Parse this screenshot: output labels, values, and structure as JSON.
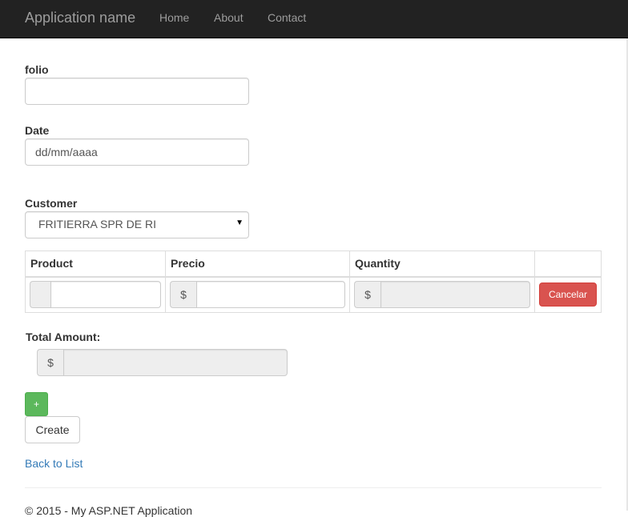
{
  "navbar": {
    "brand": "Application name",
    "links": [
      "Home",
      "About",
      "Contact"
    ]
  },
  "form": {
    "folio": {
      "label": "folio",
      "value": ""
    },
    "date": {
      "label": "Date",
      "placeholder": "dd/mm/aaaa"
    },
    "customer": {
      "label": "Customer",
      "selected": "FRITIERRA SPR DE RI"
    }
  },
  "table": {
    "headers": [
      "Product",
      "Precio",
      "Quantity",
      ""
    ],
    "row": {
      "product_addon": "",
      "precio_addon": "$",
      "quantity_addon": "$",
      "cancel_label": "Cancelar"
    }
  },
  "total": {
    "label": "Total Amount:",
    "addon": "$"
  },
  "actions": {
    "add_label": "+",
    "create_label": "Create",
    "back_link": "Back to List"
  },
  "footer": {
    "text": "© 2015 - My ASP.NET Application"
  },
  "colors": {
    "navbar": "#222222",
    "danger": "#d9534f",
    "success": "#5cb85c",
    "link": "#337ab7"
  }
}
